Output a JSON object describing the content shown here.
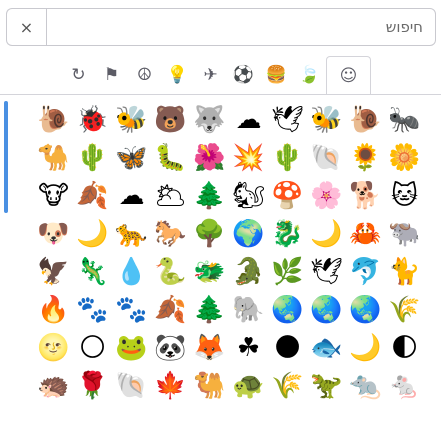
{
  "search": {
    "clear_label": "×",
    "placeholder": "חיפוש"
  },
  "categories": [
    {
      "name": "smileys",
      "icon": "☺"
    },
    {
      "name": "animals-nature",
      "icon": "🍃"
    },
    {
      "name": "food-drink",
      "icon": "🍔"
    },
    {
      "name": "activities",
      "icon": "⚽"
    },
    {
      "name": "travel-places",
      "icon": "✈"
    },
    {
      "name": "objects",
      "icon": "💡"
    },
    {
      "name": "symbols",
      "icon": "☮"
    },
    {
      "name": "flags",
      "icon": "⚑"
    },
    {
      "name": "recent",
      "icon": "↻"
    }
  ],
  "active_category": "smileys",
  "emoji_rows": [
    [
      "🐜",
      "🐌",
      "🐝",
      "🕊",
      "☁",
      "🐺",
      "🐻",
      "🐝",
      "🐞",
      "🐌"
    ],
    [
      "🌼",
      "🌻",
      "🐚",
      "🌵",
      "💥",
      "🌺",
      "🐛",
      "🦋",
      "🌵",
      "🐪"
    ],
    [
      "🐱",
      "🐕",
      "🌸",
      "🍄",
      "🐿",
      "🌲",
      "🌥",
      "☁",
      "🍂",
      "🐮"
    ],
    [
      "🐃",
      "🦀",
      "🌙",
      "🐉",
      "🌍",
      "🌳",
      "🐎",
      "🐆",
      "🌙",
      "🐶"
    ],
    [
      "🐈",
      "🐬",
      "🕊",
      "🌿",
      "🐊",
      "🐲",
      "🐍",
      "💧",
      "🦎",
      "🦅"
    ],
    [
      "🌾",
      "🌏",
      "🌏",
      "🌏",
      "🐘",
      "🌲",
      "🍂",
      "🐾",
      "🐾",
      "🔥"
    ],
    [
      "🌓",
      "🌙",
      "🐟",
      "🌑",
      "☘",
      "🦊",
      "🐼",
      "🐸",
      "🌕",
      "🌝"
    ],
    [
      "🐁",
      "🐀",
      "🦖",
      "🌾",
      "🐢",
      "🐫",
      "🍁",
      "🐚",
      "🌹",
      "🦔"
    ]
  ]
}
